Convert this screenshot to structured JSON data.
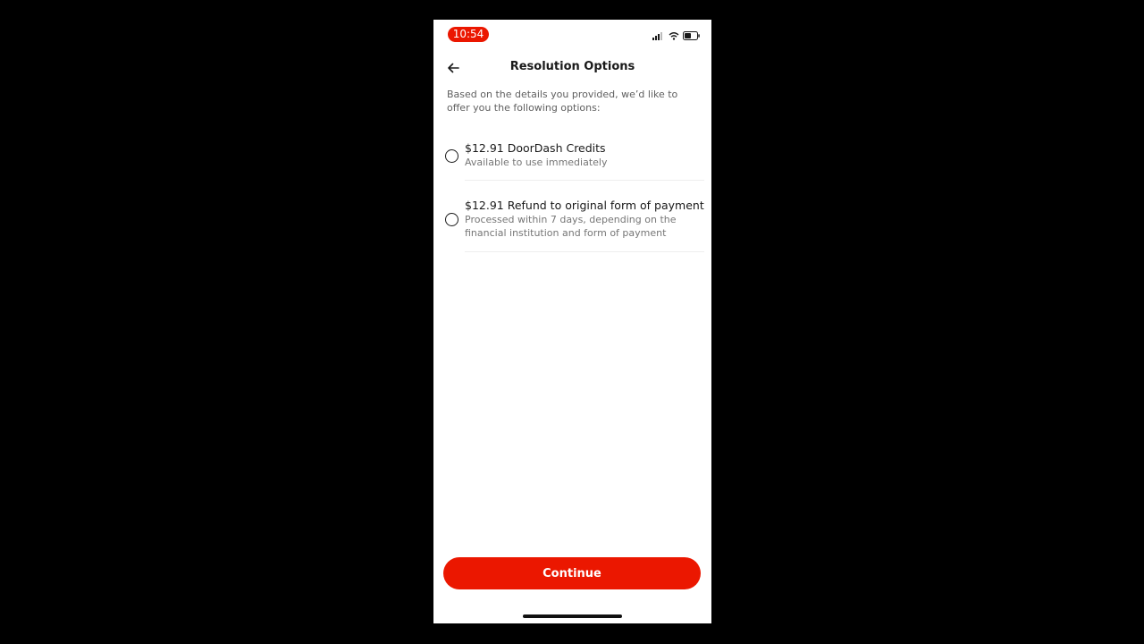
{
  "status_bar": {
    "time": "10:54",
    "accent_color": "#eb1700",
    "icons": [
      "signal-icon",
      "wifi-icon",
      "battery-icon"
    ]
  },
  "header": {
    "back_icon": "arrow-left-icon",
    "title": "Resolution Options"
  },
  "intro": "Based on the details you provided, we’d like to offer you the following options:",
  "options": [
    {
      "title": "$12.91 DoorDash Credits",
      "description": "Available to use immediately",
      "selected": false
    },
    {
      "title": "$12.91 Refund to original form of payment",
      "description": "Processed within 7 days, depending on the financial institution and form of payment",
      "selected": false
    }
  ],
  "footer": {
    "continue_label": "Continue",
    "button_color": "#eb1700"
  }
}
